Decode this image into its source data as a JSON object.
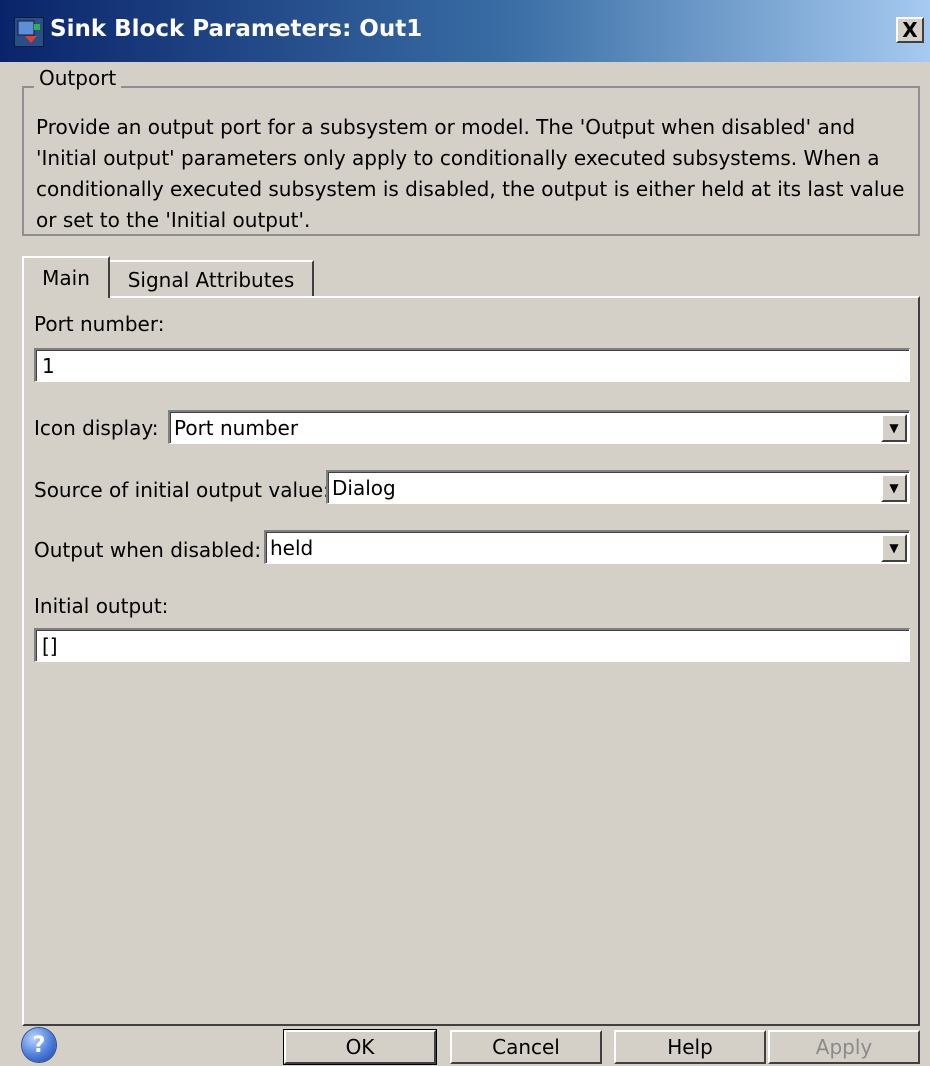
{
  "window": {
    "title": "Sink Block Parameters: Out1",
    "close_label": "X"
  },
  "group": {
    "label": "Outport",
    "description": "Provide an output port for a subsystem or model.  The 'Output when disabled' and 'Initial output' parameters only apply to conditionally executed subsystems. When a conditionally executed subsystem is disabled, the output is either held at its last value or set to the 'Initial output'."
  },
  "tabs": [
    {
      "label": "Main",
      "active": true
    },
    {
      "label": "Signal Attributes",
      "active": false
    }
  ],
  "main": {
    "port_number_label": "Port number:",
    "port_number_value": "1",
    "icon_display_label": "Icon display:",
    "icon_display_value": "Port number",
    "source_initial_label": "Source of initial output value:",
    "source_initial_value": "Dialog",
    "output_disabled_label": "Output when disabled:",
    "output_disabled_value": "held",
    "initial_output_label": "Initial output:",
    "initial_output_value": "[]"
  },
  "buttons": {
    "help_icon": "?",
    "ok": "OK",
    "cancel": "Cancel",
    "help": "Help",
    "apply": "Apply"
  },
  "colors": {
    "dialog_bg": "#d4d0c8",
    "titlebar_start": "#0a246a",
    "titlebar_end": "#a6caf0",
    "disabled_text": "#8a8a8a"
  },
  "icons": {
    "app": "simulink-block-icon",
    "close": "close-icon",
    "dropdown": "chevron-down-icon",
    "help": "help-icon"
  }
}
